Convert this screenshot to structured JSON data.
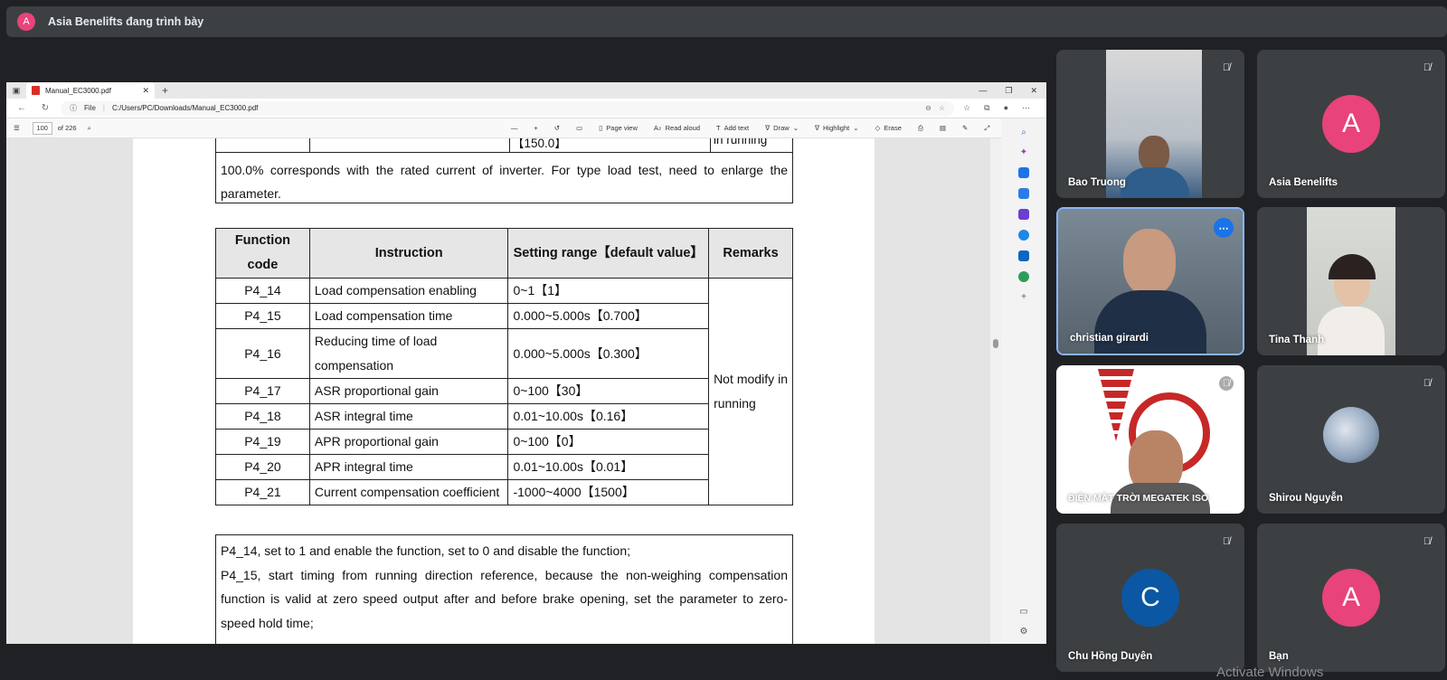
{
  "presenter": {
    "avatar_letter": "A",
    "text": "Asia Benelifts đang trình bày"
  },
  "browser": {
    "tab_title": "Manual_EC3000.pdf",
    "url_label": "File",
    "url": "C:/Users/PC/Downloads/Manual_EC3000.pdf",
    "page_number": "100",
    "page_total": "of 226",
    "tools": {
      "page_view": "Page view",
      "read_aloud": "Read aloud",
      "add_text": "Add text",
      "draw": "Draw",
      "highlight": "Highlight",
      "erase": "Erase"
    }
  },
  "document": {
    "top_row": {
      "range": "【150.0】",
      "remark": "in running"
    },
    "note_top": "100.0% corresponds with the rated current of inverter. For type load test, need to enlarge the parameter.",
    "table": {
      "headers": [
        "Function code",
        "Instruction",
        "Setting range【default value】",
        "Remarks"
      ],
      "rows": [
        {
          "code": "P4_14",
          "instruction": "Load compensation enabling",
          "range": "0~1【1】"
        },
        {
          "code": "P4_15",
          "instruction": "Load compensation time",
          "range": "0.000~5.000s【0.700】"
        },
        {
          "code": "P4_16",
          "instruction": "Reducing time of load compensation",
          "range": "0.000~5.000s【0.300】"
        },
        {
          "code": "P4_17",
          "instruction": "ASR proportional gain",
          "range": "0~100【30】"
        },
        {
          "code": "P4_18",
          "instruction": "ASR integral time",
          "range": "0.01~10.00s【0.16】"
        },
        {
          "code": "P4_19",
          "instruction": "APR proportional gain",
          "range": "0~100【0】"
        },
        {
          "code": "P4_20",
          "instruction": "APR integral time",
          "range": "0.01~10.00s【0.01】"
        },
        {
          "code": "P4_21",
          "instruction": "Current compensation coefficient",
          "range": "-1000~4000【1500】"
        }
      ],
      "remarks": "Not modify in running"
    },
    "notes": [
      "P4_14, set to 1 and enable the function, set to 0 and disable the function;",
      "P4_15, start timing from running direction reference, because the non-weighing compensation function is valid at zero speed output after and before brake opening, set the parameter to zero-speed hold time;"
    ]
  },
  "participants": [
    {
      "name": "Bao Truong",
      "type": "video"
    },
    {
      "name": "Asia Benelifts",
      "type": "avatar",
      "letter": "A",
      "color": "#e8437a"
    },
    {
      "name": "christian girardi",
      "type": "video"
    },
    {
      "name": "Tina Thanh",
      "type": "video"
    },
    {
      "name": "ĐIỆN MẶT TRỜI MEGATEK ISO",
      "type": "video"
    },
    {
      "name": "Shirou Nguyễn",
      "type": "photo"
    },
    {
      "name": "Chu Hồng Duyên",
      "type": "avatar",
      "letter": "C",
      "color": "#0b57a4"
    },
    {
      "name": "Bạn",
      "type": "avatar",
      "letter": "A",
      "color": "#e8437a"
    }
  ],
  "watermark": "Activate Windows"
}
